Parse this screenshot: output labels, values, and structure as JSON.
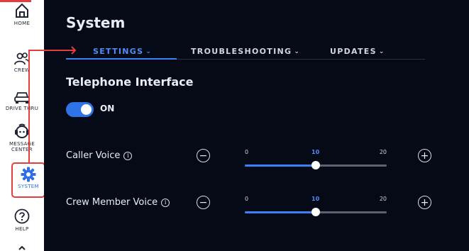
{
  "sidebar": {
    "items": [
      {
        "label": "HOME",
        "icon": "home-icon"
      },
      {
        "label": "CREW",
        "icon": "crew-icon"
      },
      {
        "label": "DRIVE THRU",
        "icon": "car-icon"
      },
      {
        "label": "MESSAGE",
        "label2": "CENTER",
        "icon": "message-center-icon"
      },
      {
        "label": "SYSTEM",
        "icon": "gear-icon",
        "selected": true
      },
      {
        "label": "HELP",
        "icon": "help-icon"
      }
    ]
  },
  "main": {
    "title": "System",
    "tabs": [
      {
        "label": "SETTINGS",
        "active": true
      },
      {
        "label": "TROUBLESHOOTING",
        "active": false
      },
      {
        "label": "UPDATES",
        "active": false
      }
    ],
    "section_title": "Telephone Interface",
    "toggle": {
      "state_label": "ON",
      "on": true
    },
    "controls": [
      {
        "label": "Caller Voice",
        "min": "0",
        "value": "10",
        "max": "20",
        "value_num": 10,
        "min_num": 0,
        "max_num": 20
      },
      {
        "label": "Crew Member Voice",
        "min": "0",
        "value": "10",
        "max": "20",
        "value_num": 10,
        "min_num": 0,
        "max_num": 20
      }
    ]
  },
  "colors": {
    "accent": "#3b82f6",
    "panel_bg": "#050a16",
    "annotation": "#e43d3d"
  }
}
